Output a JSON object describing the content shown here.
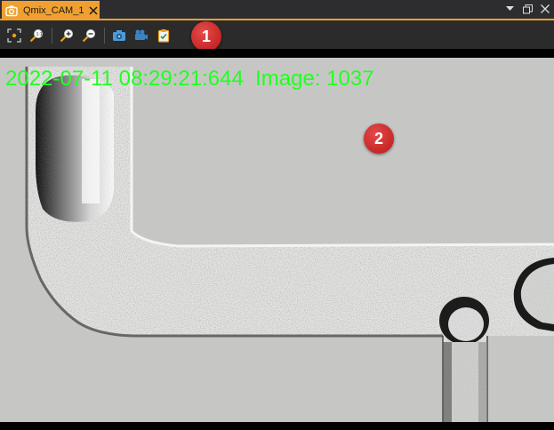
{
  "window": {
    "tab_title": "Qmix_CAM_1",
    "tab_icon": "camera-icon",
    "accent_color": "#f0a030",
    "controls": [
      "dropdown-arrow-icon",
      "restore-icon",
      "close-icon"
    ]
  },
  "toolbar": {
    "buttons": [
      {
        "icon": "fit-to-view-icon"
      },
      {
        "icon": "zoom-1to1-icon"
      },
      {
        "icon": "zoom-in-icon"
      },
      {
        "icon": "zoom-out-icon"
      },
      {
        "icon": "snapshot-camera-icon"
      },
      {
        "icon": "record-video-icon"
      },
      {
        "icon": "clipboard-icon"
      }
    ]
  },
  "badges": {
    "toolbar_badge": "1",
    "image_badge": "2",
    "color": "#c62020"
  },
  "viewport": {
    "overlay_text": "2022-07-11 08:29:21:644  Image: 1037",
    "overlay_color": "#22ff22"
  }
}
